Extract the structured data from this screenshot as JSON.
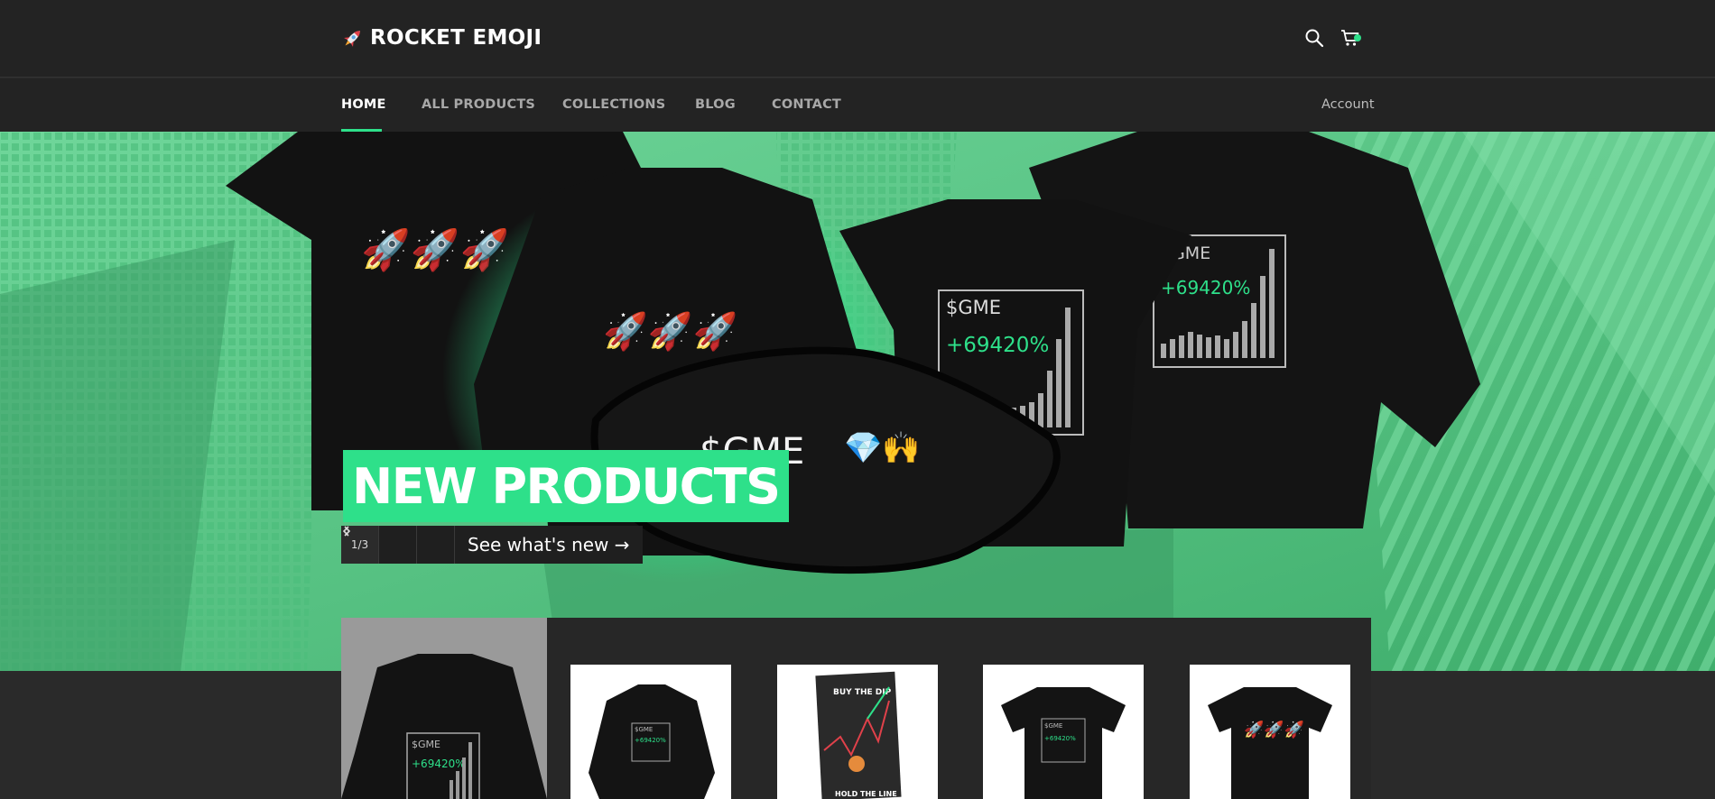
{
  "header": {
    "brand": "ROCKET EMOJI",
    "icons": [
      "rocket-icon",
      "search-icon",
      "cart-icon"
    ]
  },
  "nav": {
    "items": [
      {
        "label": "HOME",
        "active": true
      },
      {
        "label": "ALL PRODUCTS",
        "active": false
      },
      {
        "label": "COLLECTIONS",
        "active": false
      },
      {
        "label": "BLOG",
        "active": false
      },
      {
        "label": "CONTACT",
        "active": false
      }
    ],
    "account_label": "Account"
  },
  "hero": {
    "title": "NEW PRODUCTS",
    "slide_counter": "1/3",
    "prev_icon": "chevron-left-icon",
    "next_icon": "chevron-right-icon",
    "cta_label": "See what's new →",
    "print_ticker": "$GME",
    "print_gain": "+69420%",
    "accent_color": "#2ee08a",
    "overlay_color": "#57c985"
  },
  "products": {
    "thumbnails": [
      {
        "name": "gme-hoodie-thumb"
      },
      {
        "name": "buy-the-dip-poster-thumb",
        "top_text": "BUY THE DIP",
        "bottom_text": "HOLD THE LINE"
      },
      {
        "name": "gme-tshirt-thumb"
      },
      {
        "name": "rocket-tshirt-thumb"
      }
    ]
  }
}
